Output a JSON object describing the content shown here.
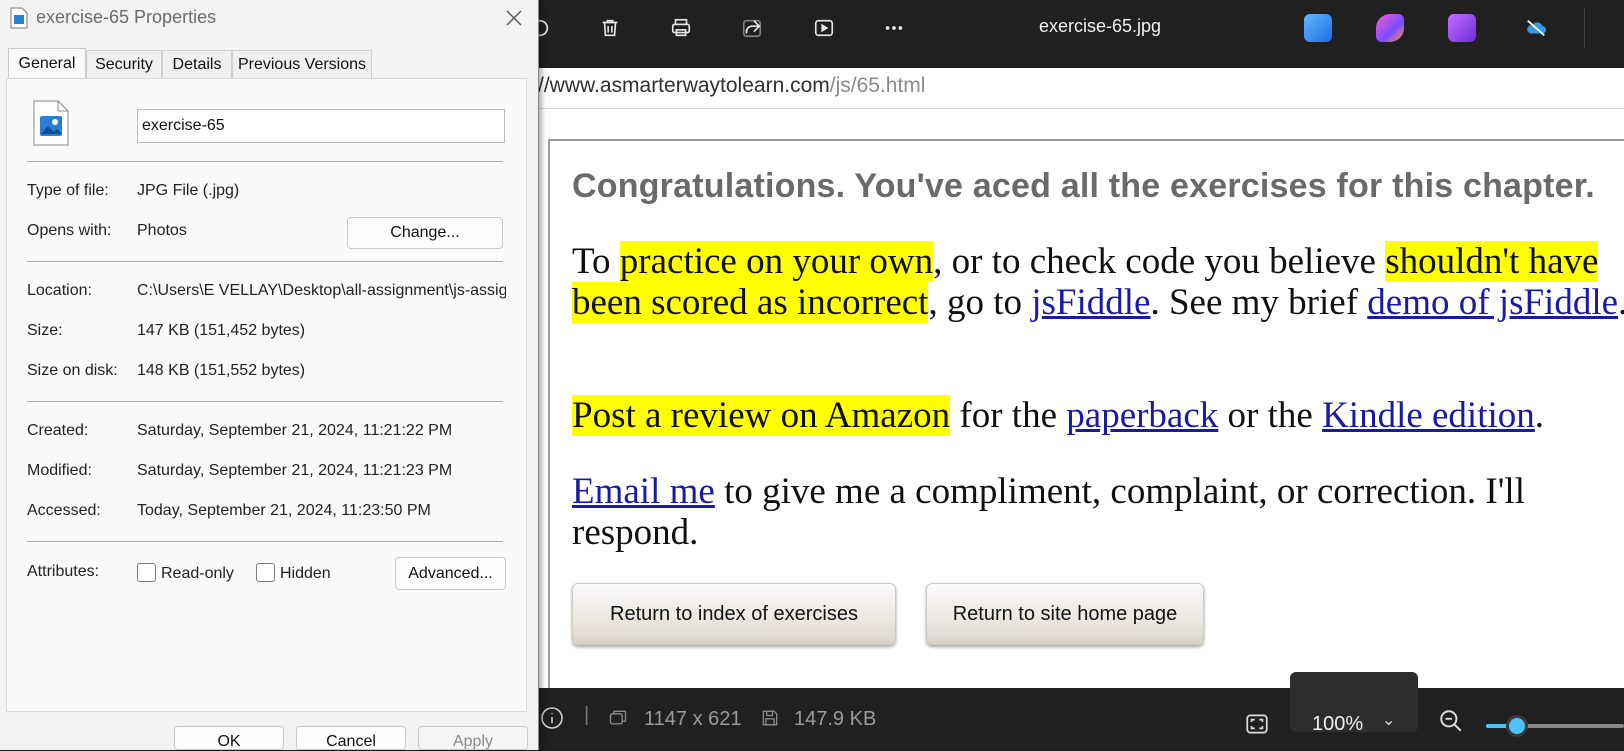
{
  "viewer": {
    "title": "exercise-65.jpg",
    "toolbar": [
      "rotate-icon",
      "delete-icon",
      "print-icon",
      "share-icon",
      "slideshow-icon",
      "more-icon"
    ],
    "image": {
      "url_host": "//www.asmarterwaytolearn.com",
      "url_path": "/js/65.html",
      "heading": "Congratulations. You've aced all the exercises for this chapter.",
      "p1": {
        "t1": "To ",
        "h1": "practice on your own",
        "t2": ", or to check code you believe ",
        "h2": "shouldn't have been scored as incorrect",
        "t3": ", go to ",
        "l1": "jsFiddle",
        "t4": ". See my brief ",
        "l2": "demo of jsFiddle",
        "t5": "."
      },
      "p2": {
        "h1": "Post a review on Amazon",
        "t1": " for the ",
        "l1": "paperback",
        "t2": " or the ",
        "l2": "Kindle edition",
        "t3": "."
      },
      "p3": {
        "l1": "Email me",
        "t1": " to give me a compliment, complaint, or correction. I'll respond."
      },
      "button_index": "Return to index of exercises",
      "button_home": "Return to site home page"
    },
    "status": {
      "dimensions": "1147 x 621",
      "size": "147.9 KB",
      "zoom": "100%",
      "zoom_slider_fraction": 0.2
    },
    "colors": {
      "accent": "#4cc2ff",
      "highlight": "#ffff00",
      "link": "#1a1aa6"
    }
  },
  "dialog": {
    "title": "exercise-65 Properties",
    "tabs": [
      "General",
      "Security",
      "Details",
      "Previous Versions"
    ],
    "active_tab": "General",
    "file_name": "exercise-65",
    "type_label": "Type of file:",
    "type_value": "JPG File (.jpg)",
    "opens_label": "Opens with:",
    "opens_value": "Photos",
    "change_button": "Change...",
    "location_label": "Location:",
    "location_value": "C:\\Users\\E VELLAY\\Desktop\\all-assignment\\js-assig",
    "size_label": "Size:",
    "size_value": "147 KB (151,452 bytes)",
    "disk_label": "Size on disk:",
    "disk_value": "148 KB (151,552 bytes)",
    "created_label": "Created:",
    "created_value": "Saturday, September 21, 2024, 11:21:22 PM",
    "modified_label": "Modified:",
    "modified_value": "Saturday, September 21, 2024, 11:21:23 PM",
    "accessed_label": "Accessed:",
    "accessed_value": "Today, September 21, 2024, 11:23:50 PM",
    "attributes_label": "Attributes:",
    "readonly_label": "Read-only",
    "hidden_label": "Hidden",
    "advanced_button": "Advanced...",
    "ok_button": "OK",
    "cancel_button": "Cancel",
    "apply_button": "Apply"
  }
}
